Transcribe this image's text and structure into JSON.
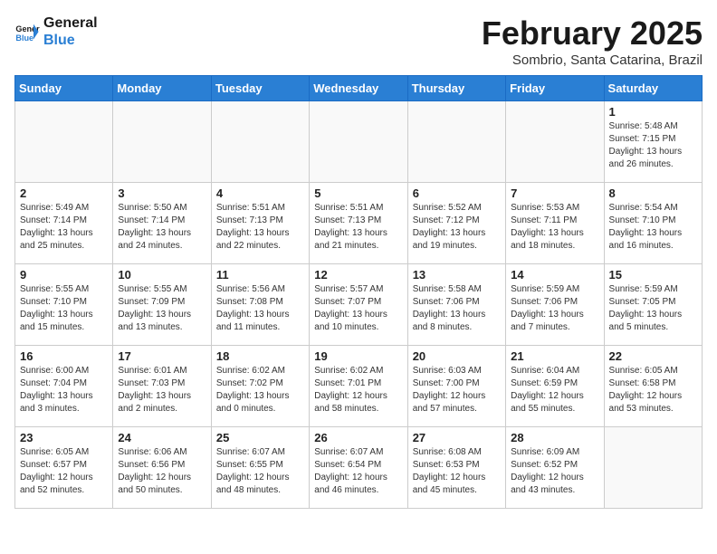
{
  "logo": {
    "line1": "General",
    "line2": "Blue"
  },
  "title": "February 2025",
  "location": "Sombrio, Santa Catarina, Brazil",
  "days_of_week": [
    "Sunday",
    "Monday",
    "Tuesday",
    "Wednesday",
    "Thursday",
    "Friday",
    "Saturday"
  ],
  "weeks": [
    [
      {
        "day": "",
        "info": ""
      },
      {
        "day": "",
        "info": ""
      },
      {
        "day": "",
        "info": ""
      },
      {
        "day": "",
        "info": ""
      },
      {
        "day": "",
        "info": ""
      },
      {
        "day": "",
        "info": ""
      },
      {
        "day": "1",
        "info": "Sunrise: 5:48 AM\nSunset: 7:15 PM\nDaylight: 13 hours\nand 26 minutes."
      }
    ],
    [
      {
        "day": "2",
        "info": "Sunrise: 5:49 AM\nSunset: 7:14 PM\nDaylight: 13 hours\nand 25 minutes."
      },
      {
        "day": "3",
        "info": "Sunrise: 5:50 AM\nSunset: 7:14 PM\nDaylight: 13 hours\nand 24 minutes."
      },
      {
        "day": "4",
        "info": "Sunrise: 5:51 AM\nSunset: 7:13 PM\nDaylight: 13 hours\nand 22 minutes."
      },
      {
        "day": "5",
        "info": "Sunrise: 5:51 AM\nSunset: 7:13 PM\nDaylight: 13 hours\nand 21 minutes."
      },
      {
        "day": "6",
        "info": "Sunrise: 5:52 AM\nSunset: 7:12 PM\nDaylight: 13 hours\nand 19 minutes."
      },
      {
        "day": "7",
        "info": "Sunrise: 5:53 AM\nSunset: 7:11 PM\nDaylight: 13 hours\nand 18 minutes."
      },
      {
        "day": "8",
        "info": "Sunrise: 5:54 AM\nSunset: 7:10 PM\nDaylight: 13 hours\nand 16 minutes."
      }
    ],
    [
      {
        "day": "9",
        "info": "Sunrise: 5:55 AM\nSunset: 7:10 PM\nDaylight: 13 hours\nand 15 minutes."
      },
      {
        "day": "10",
        "info": "Sunrise: 5:55 AM\nSunset: 7:09 PM\nDaylight: 13 hours\nand 13 minutes."
      },
      {
        "day": "11",
        "info": "Sunrise: 5:56 AM\nSunset: 7:08 PM\nDaylight: 13 hours\nand 11 minutes."
      },
      {
        "day": "12",
        "info": "Sunrise: 5:57 AM\nSunset: 7:07 PM\nDaylight: 13 hours\nand 10 minutes."
      },
      {
        "day": "13",
        "info": "Sunrise: 5:58 AM\nSunset: 7:06 PM\nDaylight: 13 hours\nand 8 minutes."
      },
      {
        "day": "14",
        "info": "Sunrise: 5:59 AM\nSunset: 7:06 PM\nDaylight: 13 hours\nand 7 minutes."
      },
      {
        "day": "15",
        "info": "Sunrise: 5:59 AM\nSunset: 7:05 PM\nDaylight: 13 hours\nand 5 minutes."
      }
    ],
    [
      {
        "day": "16",
        "info": "Sunrise: 6:00 AM\nSunset: 7:04 PM\nDaylight: 13 hours\nand 3 minutes."
      },
      {
        "day": "17",
        "info": "Sunrise: 6:01 AM\nSunset: 7:03 PM\nDaylight: 13 hours\nand 2 minutes."
      },
      {
        "day": "18",
        "info": "Sunrise: 6:02 AM\nSunset: 7:02 PM\nDaylight: 13 hours\nand 0 minutes."
      },
      {
        "day": "19",
        "info": "Sunrise: 6:02 AM\nSunset: 7:01 PM\nDaylight: 12 hours\nand 58 minutes."
      },
      {
        "day": "20",
        "info": "Sunrise: 6:03 AM\nSunset: 7:00 PM\nDaylight: 12 hours\nand 57 minutes."
      },
      {
        "day": "21",
        "info": "Sunrise: 6:04 AM\nSunset: 6:59 PM\nDaylight: 12 hours\nand 55 minutes."
      },
      {
        "day": "22",
        "info": "Sunrise: 6:05 AM\nSunset: 6:58 PM\nDaylight: 12 hours\nand 53 minutes."
      }
    ],
    [
      {
        "day": "23",
        "info": "Sunrise: 6:05 AM\nSunset: 6:57 PM\nDaylight: 12 hours\nand 52 minutes."
      },
      {
        "day": "24",
        "info": "Sunrise: 6:06 AM\nSunset: 6:56 PM\nDaylight: 12 hours\nand 50 minutes."
      },
      {
        "day": "25",
        "info": "Sunrise: 6:07 AM\nSunset: 6:55 PM\nDaylight: 12 hours\nand 48 minutes."
      },
      {
        "day": "26",
        "info": "Sunrise: 6:07 AM\nSunset: 6:54 PM\nDaylight: 12 hours\nand 46 minutes."
      },
      {
        "day": "27",
        "info": "Sunrise: 6:08 AM\nSunset: 6:53 PM\nDaylight: 12 hours\nand 45 minutes."
      },
      {
        "day": "28",
        "info": "Sunrise: 6:09 AM\nSunset: 6:52 PM\nDaylight: 12 hours\nand 43 minutes."
      },
      {
        "day": "",
        "info": ""
      }
    ]
  ]
}
